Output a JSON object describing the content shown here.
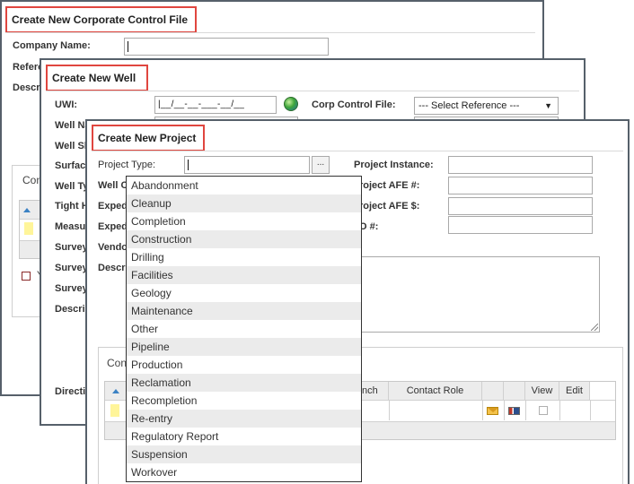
{
  "corporate_window": {
    "title": "Create New Corporate Control File",
    "labels": {
      "company_name": "Company Name:",
      "reference": "Refere",
      "description": "Descr"
    },
    "company_name_value": "",
    "group_title": "Con",
    "checkbox_label": "Y"
  },
  "well_window": {
    "title": "Create New Well",
    "labels": {
      "uwi": "UWI:",
      "corp_control_file": "Corp Control File:",
      "well_name": "Well Na",
      "well_short": "Well Sh",
      "surface": "Surfac",
      "well_type": "Well Ty",
      "tight": "Tight H",
      "measured": "Measu",
      "survey1": "Survey",
      "survey2": "Survey",
      "survey3": "Survey",
      "descrip": "Descrip",
      "direction": "Directi"
    },
    "uwi_mask": "|__/__-__-___-__/__",
    "corp_control_select": "--- Select Reference ---",
    "select_arrow": "▼"
  },
  "project_window": {
    "title": "Create New Project",
    "labels": {
      "project_type": "Project Type:",
      "well_c": "Well C",
      "exped1": "Exped",
      "exped2": "Exped",
      "vendor": "Vendo",
      "descr": "Descr",
      "project_instance": "Project Instance:",
      "project_afe_no": "roject AFE #:",
      "project_afe_dollar": "roject AFE $:",
      "o_no": "O #:"
    },
    "browse_button": "...",
    "group_title": "Con",
    "grid": {
      "headers": [
        "nch",
        "Contact Role",
        "View",
        "Edit"
      ]
    }
  },
  "project_type_options": [
    "Abandonment",
    "Cleanup",
    "Completion",
    "Construction",
    "Drilling",
    "Facilities",
    "Geology",
    "Maintenance",
    "Other",
    "Pipeline",
    "Production",
    "Reclamation",
    "Recompletion",
    "Re-entry",
    "Regulatory Report",
    "Suspension",
    "Workover"
  ],
  "colors": {
    "title_highlight": "#e0463f",
    "window_border": "#56606a",
    "alt_row": "#ebebeb"
  }
}
